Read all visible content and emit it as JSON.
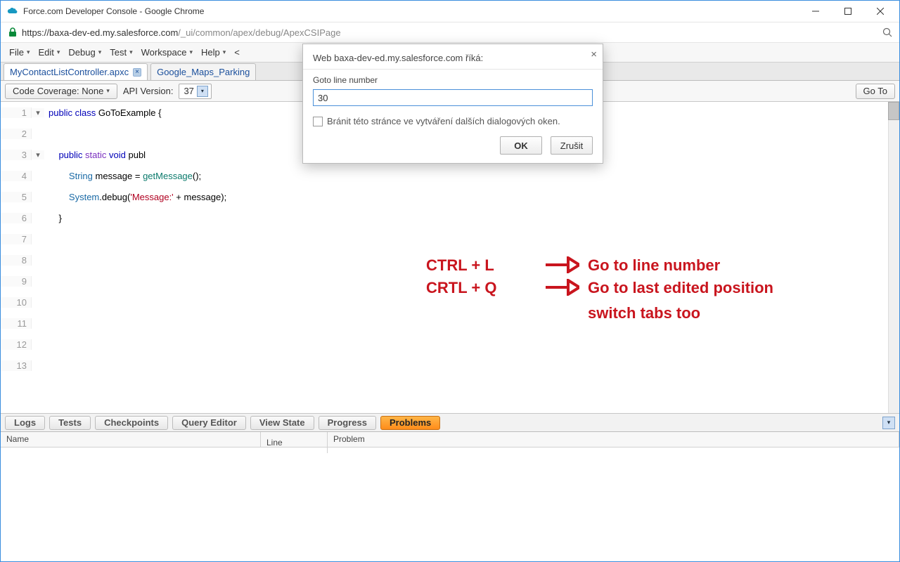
{
  "window": {
    "title": "Force.com Developer Console - Google Chrome"
  },
  "url": {
    "host": "https://baxa-dev-ed.my.salesforce.com",
    "path": "/_ui/common/apex/debug/ApexCSIPage"
  },
  "menu": {
    "file": "File",
    "edit": "Edit",
    "debug": "Debug",
    "test": "Test",
    "workspace": "Workspace",
    "help": "Help",
    "history": "<"
  },
  "tabs": {
    "a": "MyContactListController.apxc",
    "b": "Google_Maps_Parking"
  },
  "toolbar": {
    "coverage_label": "Code Coverage: None",
    "apiversion_label": "API Version:",
    "apiversion_value": "37",
    "goto": "Go To"
  },
  "code": {
    "l1_a": "public",
    "l1_b": "class",
    "l1_c": " GoToExample {",
    "l3_a": "public",
    "l3_b": "static",
    "l3_c": "void",
    "l3_d": " publ",
    "l4_a": "String",
    "l4_b": " message = ",
    "l4_c": "getMessage",
    "l4_d": "();",
    "l5_a": "System",
    "l5_b": ".debug(",
    "l5_c": "'Message:'",
    "l5_d": " + message);",
    "l6": "    }"
  },
  "linenums": [
    "1",
    "2",
    "3",
    "4",
    "5",
    "6",
    "7",
    "8",
    "9",
    "10",
    "11",
    "12",
    "13"
  ],
  "bottom": {
    "logs": "Logs",
    "tests": "Tests",
    "checkpoints": "Checkpoints",
    "query": "Query Editor",
    "viewstate": "View State",
    "progress": "Progress",
    "problems": "Problems"
  },
  "cols": {
    "name": "Name",
    "line": "Line",
    "problem": "Problem"
  },
  "dialog": {
    "headline": "Web baxa-dev-ed.my.salesforce.com říká:",
    "label": "Goto line number",
    "value": "30",
    "checkbox": "Bránit této stránce ve vytváření dalších dialogových oken.",
    "ok": "OK",
    "cancel": "Zrušit"
  },
  "annotations": {
    "ctrl_l": "CTRL + L",
    "ctrl_q": "CRTL + Q",
    "goto_line": "Go to line number",
    "goto_last": "Go to last edited position",
    "switch": "switch tabs too"
  }
}
